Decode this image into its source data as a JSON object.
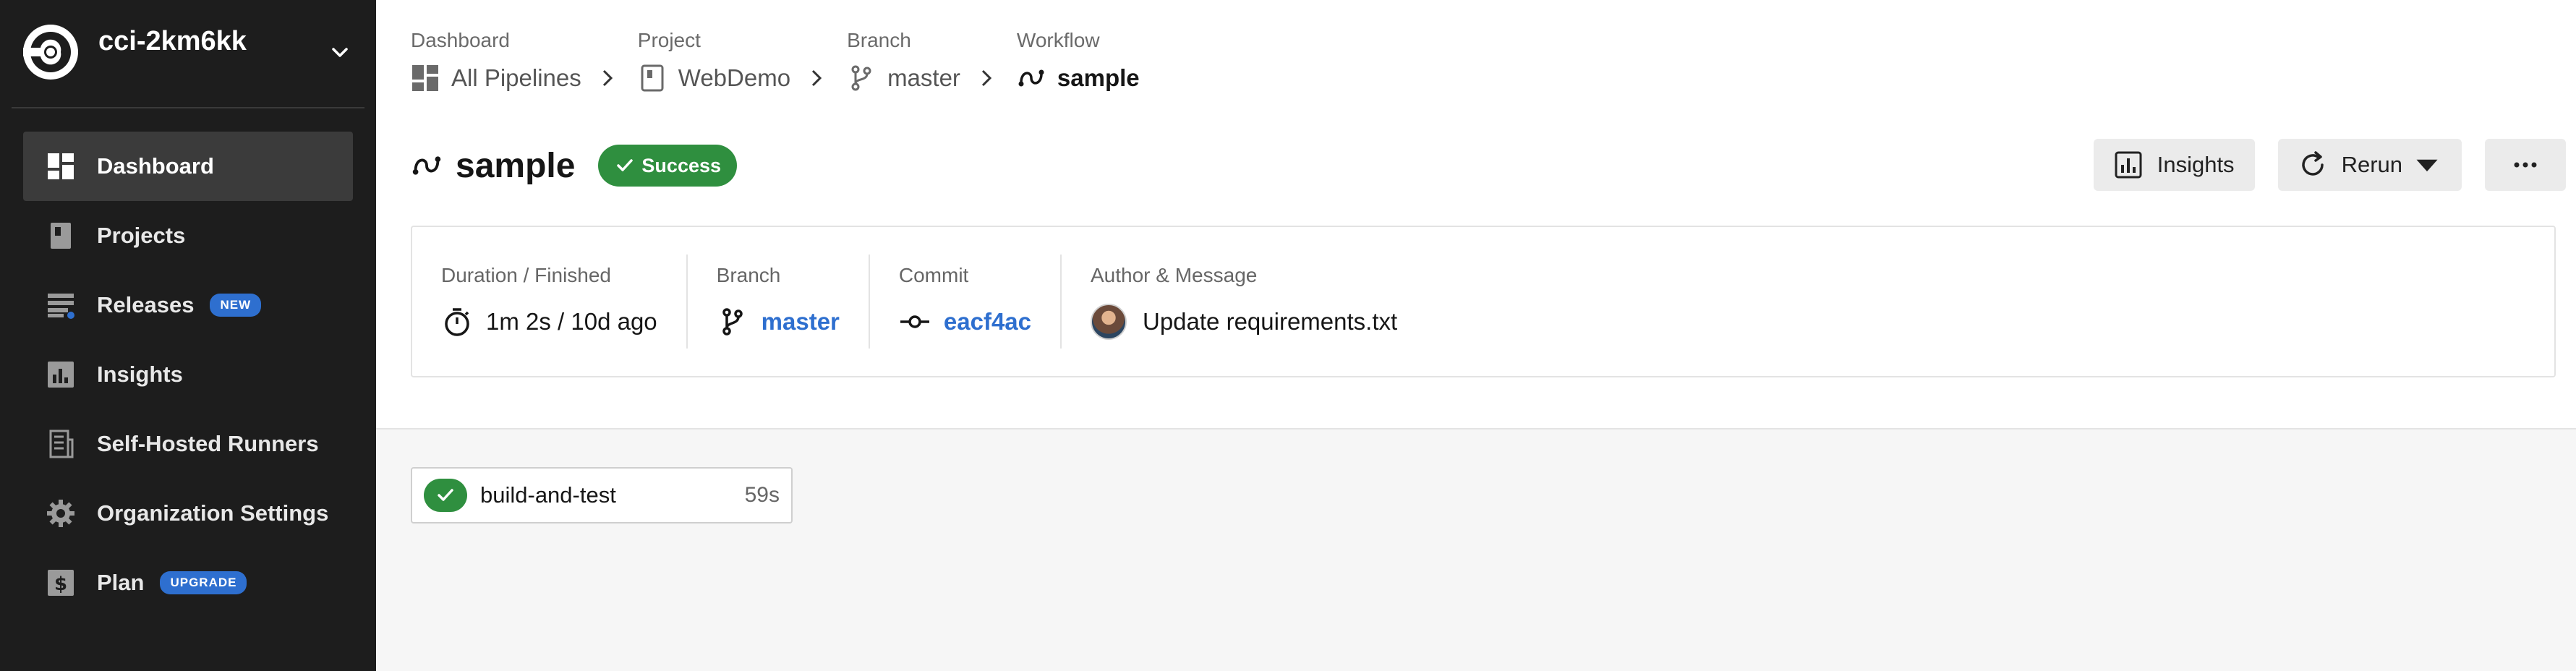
{
  "org": {
    "name": "cci-2km6kk"
  },
  "sidebar": {
    "items": [
      {
        "label": "Dashboard",
        "icon": "dashboard-icon",
        "active": true
      },
      {
        "label": "Projects",
        "icon": "project-icon"
      },
      {
        "label": "Releases",
        "icon": "releases-icon",
        "badge": "NEW"
      },
      {
        "label": "Insights",
        "icon": "insights-icon"
      },
      {
        "label": "Self-Hosted Runners",
        "icon": "runner-icon"
      },
      {
        "label": "Organization Settings",
        "icon": "gear-icon"
      },
      {
        "label": "Plan",
        "icon": "dollar-icon",
        "badge": "UPGRADE"
      }
    ]
  },
  "breadcrumbs": [
    {
      "caption": "Dashboard",
      "label": "All Pipelines",
      "icon": "dashboard-icon"
    },
    {
      "caption": "Project",
      "label": "WebDemo",
      "icon": "project-icon"
    },
    {
      "caption": "Branch",
      "label": "master",
      "icon": "branch-icon"
    },
    {
      "caption": "Workflow",
      "label": "sample",
      "icon": "workflow-icon"
    }
  ],
  "workflow": {
    "title": "sample",
    "status": "Success"
  },
  "actions": {
    "insights_label": "Insights",
    "rerun_label": "Rerun"
  },
  "details": {
    "duration_label": "Duration / Finished",
    "duration_value": "1m 2s / 10d ago",
    "branch_label": "Branch",
    "branch_value": "master",
    "commit_label": "Commit",
    "commit_value": "eacf4ac",
    "author_label": "Author & Message",
    "author_message": "Update requirements.txt"
  },
  "jobs": [
    {
      "name": "build-and-test",
      "duration": "59s",
      "status": "success"
    }
  ],
  "colors": {
    "sidebar_bg": "#1d1d1d",
    "success": "#2f8f3f",
    "link": "#2e6fcf",
    "badge": "#2e6fcf"
  }
}
